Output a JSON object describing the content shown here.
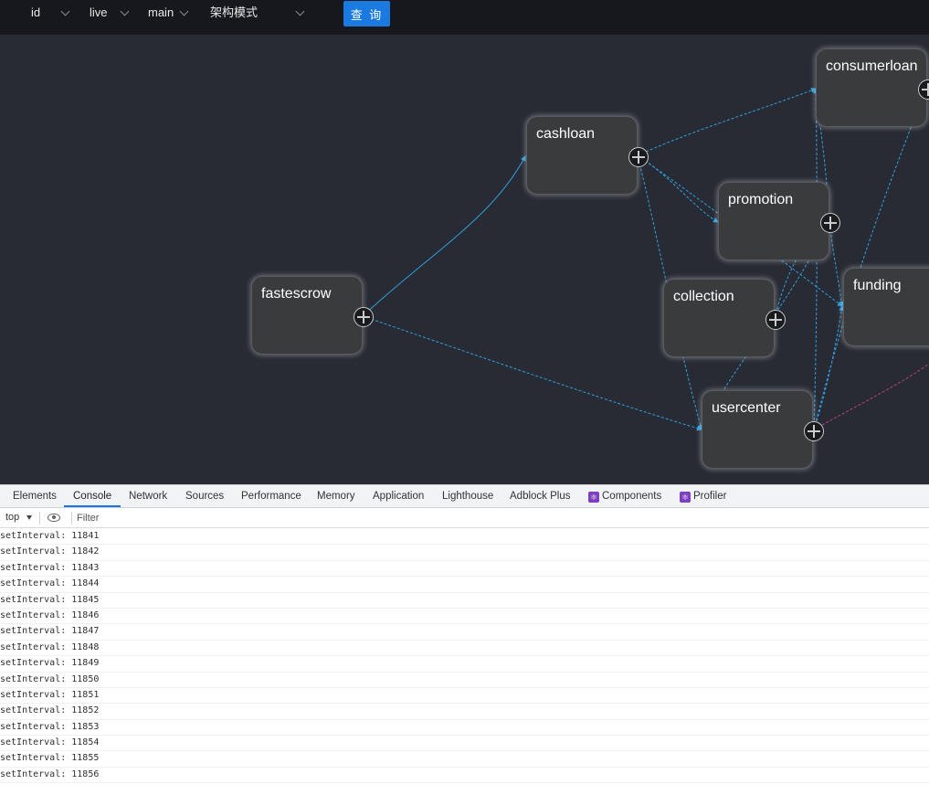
{
  "toolbar": {
    "selects": [
      {
        "value": "id"
      },
      {
        "value": "live"
      },
      {
        "value": "main"
      },
      {
        "value": "架构模式"
      }
    ],
    "query_label": "查 询"
  },
  "graph": {
    "edge_color": "#2f9fe0",
    "edge_alt_color": "#b5476a",
    "nodes": [
      {
        "id": "fastescrow",
        "label": "fastescrow"
      },
      {
        "id": "cashloan",
        "label": "cashloan"
      },
      {
        "id": "consumerloan",
        "label": "consumerloan"
      },
      {
        "id": "promotion",
        "label": "promotion"
      },
      {
        "id": "collection",
        "label": "collection"
      },
      {
        "id": "funding",
        "label": "funding"
      },
      {
        "id": "usercenter",
        "label": "usercenter"
      }
    ]
  },
  "devtools": {
    "tabs": [
      "Elements",
      "Console",
      "Network",
      "Sources",
      "Performance",
      "Memory",
      "Application",
      "Lighthouse",
      "Adblock Plus",
      "Components",
      "Profiler"
    ],
    "active_tab": "Console",
    "context": "top",
    "filter_placeholder": "Filter",
    "logs": [
      "setInterval: 11841",
      "setInterval: 11842",
      "setInterval: 11843",
      "setInterval: 11844",
      "setInterval: 11845",
      "setInterval: 11846",
      "setInterval: 11847",
      "setInterval: 11848",
      "setInterval: 11849",
      "setInterval: 11850",
      "setInterval: 11851",
      "setInterval: 11852",
      "setInterval: 11853",
      "setInterval: 11854",
      "setInterval: 11855",
      "setInterval: 11856"
    ]
  }
}
